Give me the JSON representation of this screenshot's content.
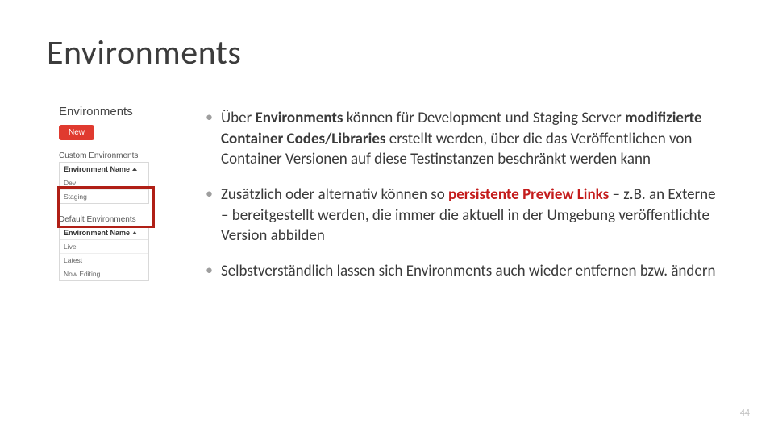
{
  "title": "Environments",
  "sidebar": {
    "heading": "Environments",
    "new_btn": "New",
    "custom_heading": "Custom Environments",
    "col_header": "Environment Name",
    "custom_rows": [
      "Dev",
      "Staging"
    ],
    "default_heading": "Default Environments",
    "default_rows": [
      "Live",
      "Latest",
      "Now Editing"
    ]
  },
  "bullets": {
    "b1": {
      "pre": "Über ",
      "strong1": "Environments",
      "mid": " können für Development und Staging Server ",
      "strong2": "modifizierte Container Codes/Libraries",
      "post": " erstellt werden, über die das Veröffentlichen von Container Versionen auf diese Testinstanzen beschränkt werden kann"
    },
    "b2": {
      "pre": "Zusätzlich oder alternativ können so ",
      "strong": "persistente Preview Links",
      "post": " – z.B. an Externe – bereitgestellt werden, die immer die aktuell in der Umgebung veröffentlichte Version abbilden"
    },
    "b3": {
      "text": "Selbstverständlich lassen sich Environments auch wieder entfernen bzw. ändern"
    }
  },
  "page_number": "44"
}
